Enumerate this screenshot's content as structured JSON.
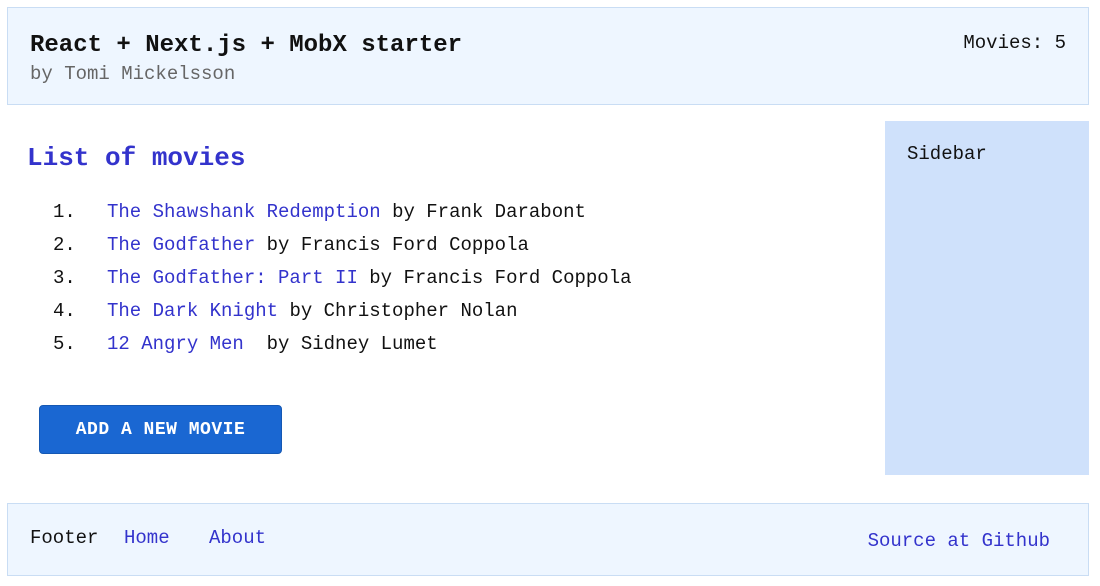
{
  "header": {
    "title": "React + Next.js + MobX starter",
    "subtitle": "by Tomi Mickelsson",
    "movie_count": "Movies: 5"
  },
  "main": {
    "heading": "List of movies",
    "movies": [
      {
        "number": "1.",
        "title": "The Shawshank Redemption",
        "director": "by Frank Darabont"
      },
      {
        "number": "2.",
        "title": "The Godfather",
        "director": "by Francis Ford Coppola"
      },
      {
        "number": "3.",
        "title": "The Godfather: Part II",
        "director": "by Francis Ford Coppola"
      },
      {
        "number": "4.",
        "title": "The Dark Knight",
        "director": "by Christopher Nolan"
      },
      {
        "number": "5.",
        "title": "12 Angry Men",
        "director": " by Sidney Lumet"
      }
    ],
    "add_button_label": "ADD A NEW MOVIE"
  },
  "sidebar": {
    "title": "Sidebar"
  },
  "footer": {
    "label": "Footer",
    "home_link": "Home",
    "about_link": "About",
    "source_link": "Source at Github"
  },
  "colors": {
    "accent": "#3333cc",
    "button": "#1a67d2",
    "header_bg": "#eef6ff",
    "sidebar_bg": "#cfe1fb"
  }
}
